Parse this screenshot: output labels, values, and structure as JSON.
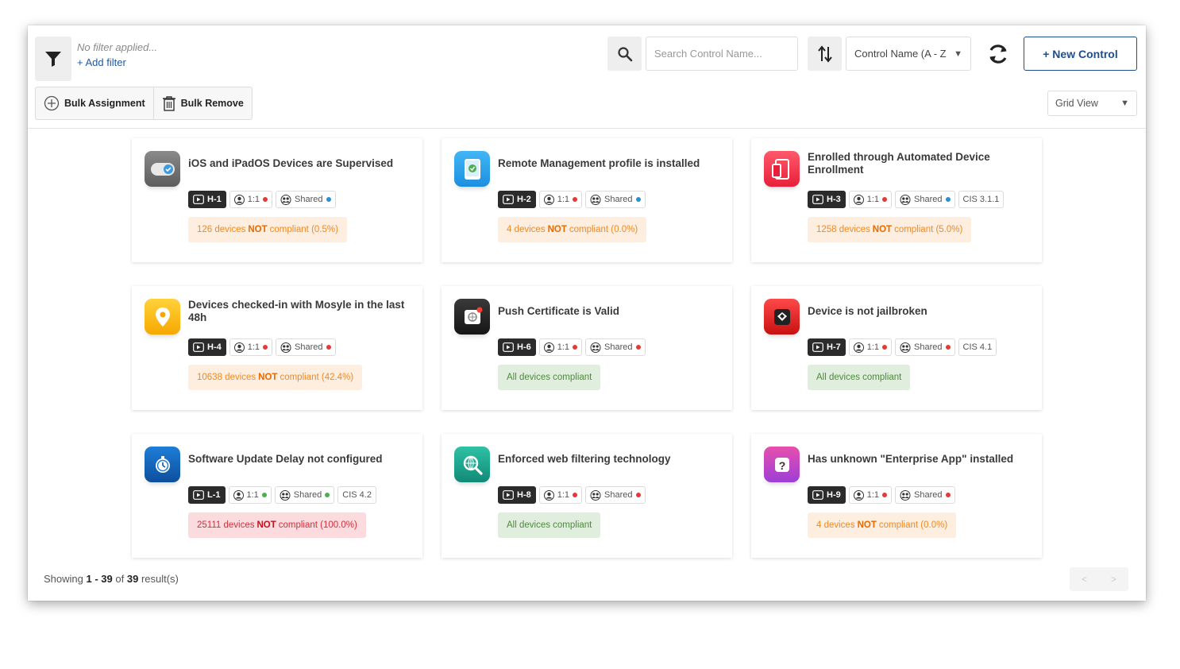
{
  "filter": {
    "none_text": "No filter applied...",
    "add_label": "+ Add filter"
  },
  "search": {
    "placeholder": "Search Control Name..."
  },
  "sort": {
    "selected": "Control Name (A - Z"
  },
  "new_control": {
    "label": "+ New Control"
  },
  "bulk": {
    "assign_label": "Bulk Assignment",
    "remove_label": "Bulk Remove"
  },
  "view": {
    "selected": "Grid View"
  },
  "colors": {
    "accent": "#1f4e8c",
    "ok_dot": "#4caf50",
    "err_dot": "#e53935",
    "info_dot": "#2b8fd6"
  },
  "cards": [
    {
      "title": "iOS and iPadOS Devices are Supervised",
      "icon": "toggle-icon",
      "code": "H-1",
      "ratio": "1:1",
      "ratio_dot": "#e53935",
      "shared": "Shared",
      "shared_dot": "#2b8fd6",
      "cis": "",
      "status": {
        "kind": "warn",
        "prefix": "126 devices",
        "not": "NOT",
        "suffix": "compliant (0.5%)"
      }
    },
    {
      "title": "Remote Management profile is installed",
      "icon": "tablet-check-icon",
      "code": "H-2",
      "ratio": "1:1",
      "ratio_dot": "#e53935",
      "shared": "Shared",
      "shared_dot": "#2b8fd6",
      "cis": "",
      "status": {
        "kind": "warn",
        "prefix": "4 devices",
        "not": "NOT",
        "suffix": "compliant (0.0%)"
      }
    },
    {
      "title": "Enrolled through Automated Device Enrollment",
      "icon": "devices-icon",
      "code": "H-3",
      "ratio": "1:1",
      "ratio_dot": "#e53935",
      "shared": "Shared",
      "shared_dot": "#2b8fd6",
      "cis": "CIS 3.1.1",
      "status": {
        "kind": "warn",
        "prefix": "1258 devices",
        "not": "NOT",
        "suffix": "compliant (5.0%)"
      }
    },
    {
      "title": "Devices checked-in with Mosyle in the last 48h",
      "icon": "location-pin-icon",
      "code": "H-4",
      "ratio": "1:1",
      "ratio_dot": "#e53935",
      "shared": "Shared",
      "shared_dot": "#e53935",
      "cis": "",
      "status": {
        "kind": "warn",
        "prefix": "10638 devices",
        "not": "NOT",
        "suffix": "compliant (42.4%)"
      }
    },
    {
      "title": "Push Certificate is Valid",
      "icon": "certificate-icon",
      "code": "H-6",
      "ratio": "1:1",
      "ratio_dot": "#e53935",
      "shared": "Shared",
      "shared_dot": "#e53935",
      "cis": "",
      "status": {
        "kind": "ok",
        "prefix": "All devices compliant",
        "not": "",
        "suffix": ""
      }
    },
    {
      "title": "Device is not jailbroken",
      "icon": "jailbreak-icon",
      "code": "H-7",
      "ratio": "1:1",
      "ratio_dot": "#e53935",
      "shared": "Shared",
      "shared_dot": "#e53935",
      "cis": "CIS 4.1",
      "status": {
        "kind": "ok",
        "prefix": "All devices compliant",
        "not": "",
        "suffix": ""
      }
    },
    {
      "title": "Software Update Delay not configured",
      "icon": "clock-icon",
      "code": "L-1",
      "ratio": "1:1",
      "ratio_dot": "#4caf50",
      "shared": "Shared",
      "shared_dot": "#4caf50",
      "cis": "CIS 4.2",
      "status": {
        "kind": "err",
        "prefix": "25111 devices",
        "not": "NOT",
        "suffix": "compliant (100.0%)"
      }
    },
    {
      "title": "Enforced web filtering technology",
      "icon": "web-search-icon",
      "code": "H-8",
      "ratio": "1:1",
      "ratio_dot": "#e53935",
      "shared": "Shared",
      "shared_dot": "#e53935",
      "cis": "",
      "status": {
        "kind": "ok",
        "prefix": "All devices compliant",
        "not": "",
        "suffix": ""
      }
    },
    {
      "title": "Has unknown \"Enterprise App\" installed",
      "icon": "question-app-icon",
      "code": "H-9",
      "ratio": "1:1",
      "ratio_dot": "#e53935",
      "shared": "Shared",
      "shared_dot": "#e53935",
      "cis": "",
      "status": {
        "kind": "warn",
        "prefix": "4 devices",
        "not": "NOT",
        "suffix": "compliant (0.0%)"
      }
    }
  ],
  "footer": {
    "showing": "Showing",
    "range": "1 - 39",
    "of": "of",
    "total": "39",
    "suffix": "result(s)"
  },
  "pager": {
    "prev": "<",
    "next": ">"
  }
}
